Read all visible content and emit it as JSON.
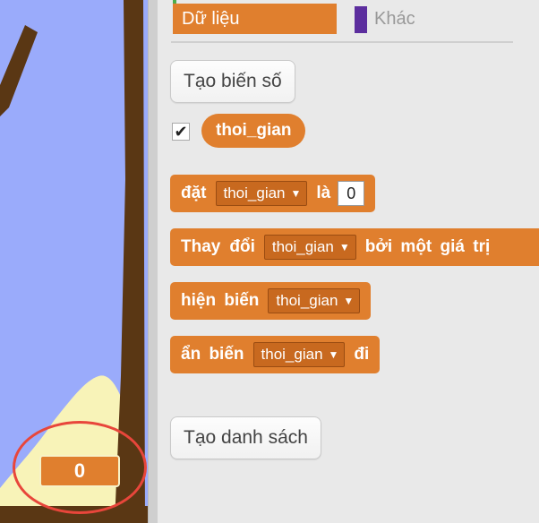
{
  "stage": {
    "variable_readout": "0"
  },
  "categories": {
    "data": "Dữ liệu",
    "other": "Khác"
  },
  "buttons": {
    "make_variable": "Tạo biến số",
    "make_list": "Tạo danh sách"
  },
  "variable": {
    "name": "thoi_gian",
    "checked": "✔"
  },
  "blocks": {
    "set": {
      "kw": "đặt",
      "var": "thoi_gian",
      "to": "là",
      "value": "0"
    },
    "change": {
      "kw1": "Thay",
      "kw2": "đổi",
      "var": "thoi_gian",
      "rest": "bởi một giá trị"
    },
    "show": {
      "kw": "hiện biến",
      "var": "thoi_gian"
    },
    "hide": {
      "kw": "ẩn biến",
      "var": "thoi_gian",
      "rest": "đi"
    },
    "arrow": "▼"
  },
  "colors": {
    "data_orange": "#e07f2e",
    "stage_sky": "#9aabfb",
    "stage_ground": "#5a3714",
    "sand": "#f8f3b8",
    "highlight_red": "#e8463b"
  }
}
